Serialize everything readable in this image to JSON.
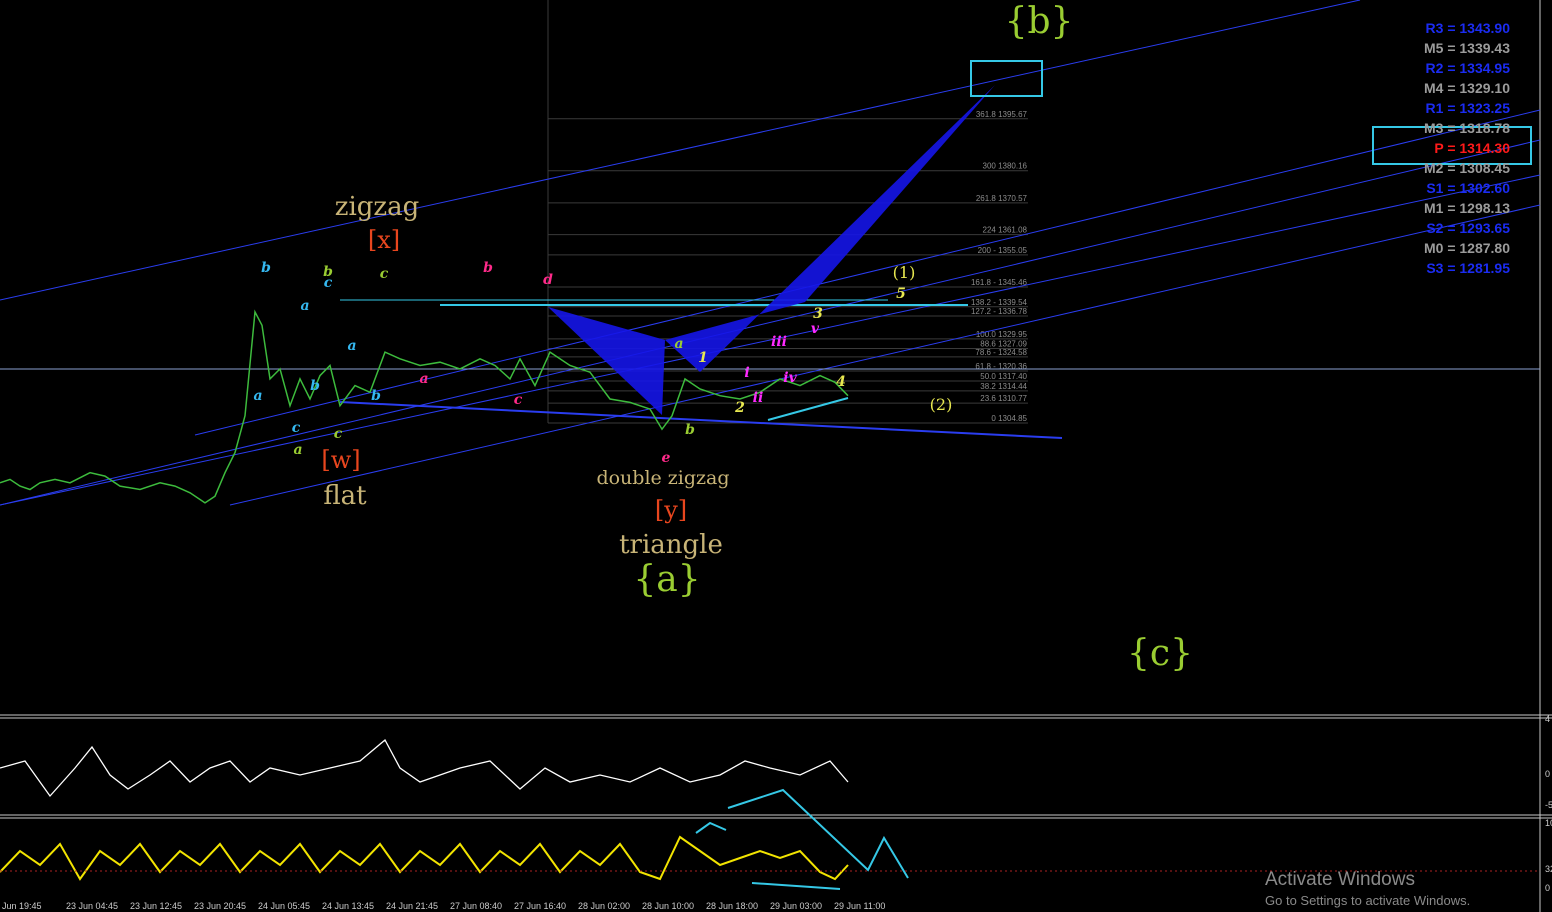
{
  "colors": {
    "background": "#000000",
    "price_line": "#3dbb3d",
    "channel": "#2a3df0",
    "pattern_fill": "#1515e8",
    "cyan": "#35c8e6",
    "fib_line": "#3a3a3a",
    "osc1": "#ffffff",
    "osc2": "#f2e400",
    "pivot_blue": "#1b2cf2",
    "pivot_gray": "#9b9b9b",
    "pivot_red": "#ff1a1a"
  },
  "pivots": [
    {
      "label": "R3 = 1343.90",
      "color": "blue"
    },
    {
      "label": "M5 = 1339.43",
      "color": "gray"
    },
    {
      "label": "R2 = 1334.95",
      "color": "blue"
    },
    {
      "label": "M4 = 1329.10",
      "color": "gray"
    },
    {
      "label": "R1 = 1323.25",
      "color": "blue"
    },
    {
      "label": "M3 = 1318.78",
      "color": "gray"
    },
    {
      "label": "P   = 1314.30",
      "color": "red"
    },
    {
      "label": "M2 = 1308.45",
      "color": "gray"
    },
    {
      "label": "S1 = 1302.60",
      "color": "blue"
    },
    {
      "label": "M1 = 1298.13",
      "color": "gray"
    },
    {
      "label": "S2 = 1293.65",
      "color": "blue"
    },
    {
      "label": "M0 = 1287.80",
      "color": "gray"
    },
    {
      "label": "S3 = 1281.95",
      "color": "blue"
    }
  ],
  "fib_levels": [
    {
      "label": "361.8  1395.67",
      "price": 1395.67
    },
    {
      "label": "300  1380.16",
      "price": 1380.16
    },
    {
      "label": "261.8  1370.57",
      "price": 1370.57
    },
    {
      "label": "224  1361.08",
      "price": 1361.08
    },
    {
      "label": "200 - 1355.05",
      "price": 1355.05
    },
    {
      "label": "161.8 - 1345.46",
      "price": 1345.46
    },
    {
      "label": "138.2 - 1339.54",
      "price": 1339.54
    },
    {
      "label": "127.2 - 1336.78",
      "price": 1336.78
    },
    {
      "label": "100.0  1329.95",
      "price": 1329.95
    },
    {
      "label": "88.6  1327.09",
      "price": 1327.09
    },
    {
      "label": "78.6 - 1324.58",
      "price": 1324.58
    },
    {
      "label": "61.8 - 1320.36",
      "price": 1320.36
    },
    {
      "label": "50.0  1317.40",
      "price": 1317.4
    },
    {
      "label": "38.2  1314.44",
      "price": 1314.44
    },
    {
      "label": "23.6  1310.77",
      "price": 1310.77
    },
    {
      "label": "0  1304.85",
      "price": 1304.85
    }
  ],
  "wave_labels": [
    {
      "text": "zigzag",
      "color": "#c8b477"
    },
    {
      "text": "[x]",
      "color": "#e8461e"
    },
    {
      "text": "[w]",
      "color": "#e8461e"
    },
    {
      "text": "flat",
      "color": "#c8b477"
    },
    {
      "text": "double zigzag",
      "color": "#c8b477"
    },
    {
      "text": "[y]",
      "color": "#e8461e"
    },
    {
      "text": "triangle",
      "color": "#c8b477"
    },
    {
      "text": "{a}",
      "color": "#9acd32"
    },
    {
      "text": "{b}",
      "color": "#9acd32"
    },
    {
      "text": "{c}",
      "color": "#9acd32"
    },
    {
      "text": "(1)",
      "color": "#e8e850"
    },
    {
      "text": "(2)",
      "color": "#e8e850"
    }
  ],
  "x_axis_labels": [
    "Jun 19:45",
    "23 Jun 04:45",
    "23 Jun 12:45",
    "23 Jun 20:45",
    "24 Jun 05:45",
    "24 Jun 13:45",
    "24 Jun 21:45",
    "27 Jun 08:40",
    "27 Jun 16:40",
    "28 Jun 02:00",
    "28 Jun 10:00",
    "28 Jun 18:00",
    "29 Jun 03:00",
    "29 Jun 11:00"
  ],
  "osc1_axis": [
    "4",
    "0",
    "-5"
  ],
  "osc2_axis": [
    "10",
    "32",
    "0"
  ],
  "watermark": {
    "line1": "Activate Windows",
    "line2": "Go to Settings to activate Windows."
  },
  "chart_data": {
    "type": "line",
    "price_path": [
      [
        0,
        1287
      ],
      [
        10,
        1288
      ],
      [
        20,
        1286
      ],
      [
        30,
        1285
      ],
      [
        40,
        1287
      ],
      [
        55,
        1288
      ],
      [
        70,
        1287
      ],
      [
        90,
        1290
      ],
      [
        105,
        1289
      ],
      [
        120,
        1286
      ],
      [
        140,
        1285
      ],
      [
        160,
        1287
      ],
      [
        175,
        1286
      ],
      [
        190,
        1284
      ],
      [
        205,
        1281
      ],
      [
        215,
        1283
      ],
      [
        225,
        1290
      ],
      [
        235,
        1296
      ],
      [
        245,
        1307
      ],
      [
        255,
        1338
      ],
      [
        262,
        1334
      ],
      [
        270,
        1318
      ],
      [
        280,
        1321
      ],
      [
        290,
        1310
      ],
      [
        300,
        1318
      ],
      [
        310,
        1312
      ],
      [
        320,
        1319
      ],
      [
        330,
        1322
      ],
      [
        340,
        1310
      ],
      [
        355,
        1316
      ],
      [
        370,
        1314
      ],
      [
        385,
        1326
      ],
      [
        400,
        1324
      ],
      [
        420,
        1322
      ],
      [
        440,
        1323
      ],
      [
        460,
        1321
      ],
      [
        480,
        1324
      ],
      [
        495,
        1322
      ],
      [
        510,
        1318
      ],
      [
        520,
        1324
      ],
      [
        535,
        1316
      ],
      [
        550,
        1326
      ],
      [
        570,
        1322
      ],
      [
        590,
        1320
      ],
      [
        610,
        1312
      ],
      [
        630,
        1311
      ],
      [
        650,
        1309
      ],
      [
        662,
        1303
      ],
      [
        672,
        1307
      ],
      [
        685,
        1318
      ],
      [
        700,
        1315
      ],
      [
        720,
        1313
      ],
      [
        740,
        1312
      ],
      [
        760,
        1314
      ],
      [
        780,
        1318
      ],
      [
        800,
        1316
      ],
      [
        820,
        1319
      ],
      [
        835,
        1317
      ],
      [
        848,
        1313
      ]
    ],
    "osc1_path": [
      [
        0,
        0.6
      ],
      [
        25,
        0.7
      ],
      [
        50,
        0.2
      ],
      [
        75,
        0.6
      ],
      [
        92,
        0.9
      ],
      [
        110,
        0.5
      ],
      [
        128,
        0.3
      ],
      [
        150,
        0.5
      ],
      [
        170,
        0.7
      ],
      [
        190,
        0.4
      ],
      [
        210,
        0.6
      ],
      [
        230,
        0.7
      ],
      [
        250,
        0.4
      ],
      [
        270,
        0.6
      ],
      [
        300,
        0.5
      ],
      [
        330,
        0.6
      ],
      [
        360,
        0.7
      ],
      [
        385,
        1.0
      ],
      [
        400,
        0.6
      ],
      [
        420,
        0.4
      ],
      [
        440,
        0.5
      ],
      [
        460,
        0.6
      ],
      [
        490,
        0.7
      ],
      [
        520,
        0.3
      ],
      [
        545,
        0.6
      ],
      [
        570,
        0.4
      ],
      [
        600,
        0.5
      ],
      [
        630,
        0.4
      ],
      [
        660,
        0.6
      ],
      [
        690,
        0.4
      ],
      [
        720,
        0.5
      ],
      [
        745,
        0.7
      ],
      [
        770,
        0.6
      ],
      [
        800,
        0.5
      ],
      [
        830,
        0.7
      ],
      [
        848,
        0.4
      ]
    ],
    "osc2_path": [
      [
        0,
        0.3
      ],
      [
        20,
        0.6
      ],
      [
        40,
        0.4
      ],
      [
        60,
        0.7
      ],
      [
        80,
        0.2
      ],
      [
        100,
        0.6
      ],
      [
        120,
        0.4
      ],
      [
        140,
        0.7
      ],
      [
        160,
        0.3
      ],
      [
        180,
        0.6
      ],
      [
        200,
        0.4
      ],
      [
        220,
        0.7
      ],
      [
        240,
        0.3
      ],
      [
        260,
        0.6
      ],
      [
        280,
        0.4
      ],
      [
        300,
        0.7
      ],
      [
        320,
        0.3
      ],
      [
        340,
        0.6
      ],
      [
        360,
        0.4
      ],
      [
        380,
        0.7
      ],
      [
        400,
        0.3
      ],
      [
        420,
        0.6
      ],
      [
        440,
        0.4
      ],
      [
        460,
        0.7
      ],
      [
        480,
        0.3
      ],
      [
        500,
        0.6
      ],
      [
        520,
        0.4
      ],
      [
        540,
        0.7
      ],
      [
        560,
        0.3
      ],
      [
        580,
        0.6
      ],
      [
        600,
        0.4
      ],
      [
        620,
        0.7
      ],
      [
        640,
        0.3
      ],
      [
        660,
        0.2
      ],
      [
        680,
        0.8
      ],
      [
        700,
        0.6
      ],
      [
        720,
        0.4
      ],
      [
        740,
        0.5
      ],
      [
        760,
        0.6
      ],
      [
        780,
        0.5
      ],
      [
        800,
        0.6
      ],
      [
        820,
        0.3
      ],
      [
        835,
        0.2
      ],
      [
        848,
        0.4
      ]
    ],
    "ylim": [
      1274,
      1396
    ]
  }
}
